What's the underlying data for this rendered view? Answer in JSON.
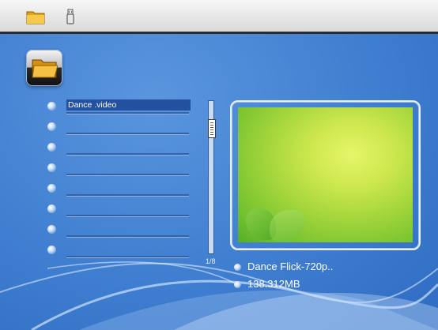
{
  "top_bar": {
    "icons": [
      "folder-icon",
      "usb-icon"
    ]
  },
  "file_list": {
    "items": [
      {
        "label": "Dance .video",
        "selected": true
      },
      {
        "label": ""
      },
      {
        "label": ""
      },
      {
        "label": ""
      },
      {
        "label": ""
      },
      {
        "label": ""
      },
      {
        "label": ""
      },
      {
        "label": ""
      }
    ],
    "page_indicator": "1/8"
  },
  "preview": {
    "title": "Dance Flick-720p..",
    "size": "138.312MB"
  },
  "colors": {
    "background": "#3f7ed0",
    "selection": "#2450a0",
    "top_bar": "#e8e8e8",
    "preview_green": "#9fd43a"
  }
}
